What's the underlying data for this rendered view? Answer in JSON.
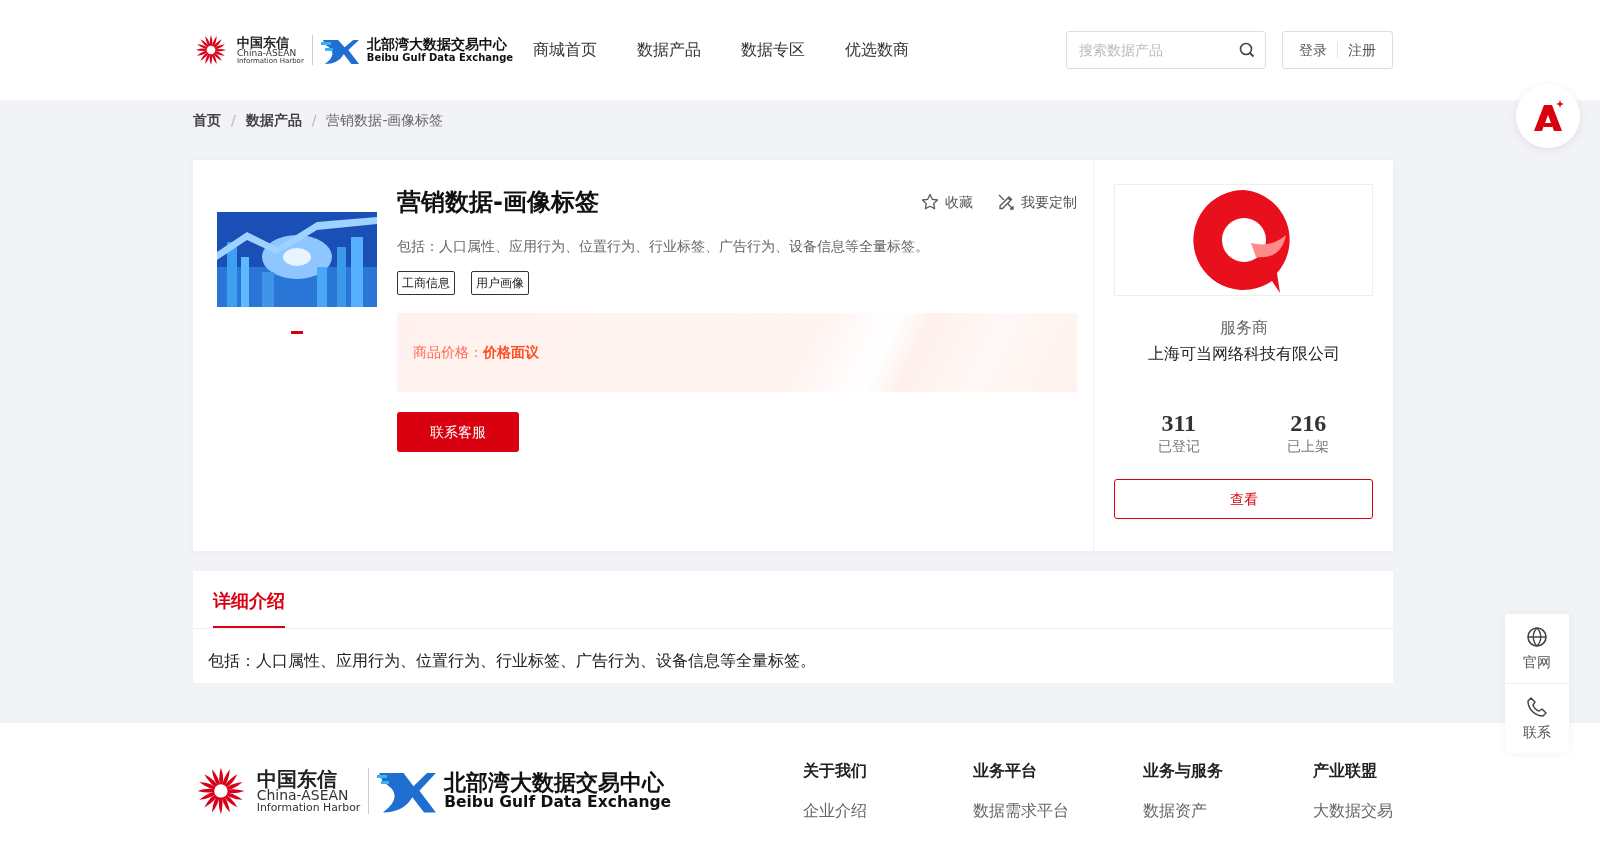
{
  "header": {
    "logo": {
      "cn": "中国东信",
      "en1": "China-ASEAN",
      "en2": "Information Harbor",
      "title": "北部湾大数据交易中心",
      "subtitle": "Beibu Gulf Data Exchange"
    },
    "nav": [
      {
        "label": "商城首页"
      },
      {
        "label": "数据产品"
      },
      {
        "label": "数据专区"
      },
      {
        "label": "优选数商"
      }
    ],
    "search": {
      "placeholder": "搜索数据产品"
    },
    "auth": [
      "登录",
      "注册"
    ]
  },
  "breadcrumb_separator": "/",
  "breadcrumb": [
    {
      "label": "首页",
      "current": false
    },
    {
      "label": "数据产品",
      "current": false
    },
    {
      "label": "营销数据-画像标签",
      "current": true
    }
  ],
  "product": {
    "title": "营销数据-画像标签",
    "actions": [
      "收藏",
      "我要定制"
    ],
    "description": "包括：人口属性、应用行为、位置行为、行业标签、广告行为、设备信息等全量标签。",
    "tags": [
      "工商信息",
      "用户画像"
    ],
    "price_label": "商品价格：",
    "price": "价格面议",
    "contact_button": "联系客服",
    "slides": [
      {
        "selected": true
      }
    ]
  },
  "provider": {
    "role": "服务商",
    "name": "上海可当网络科技有限公司",
    "stats": [
      {
        "value": "311",
        "label": "已登记"
      },
      {
        "value": "216",
        "label": "已上架"
      }
    ],
    "button": "查看"
  },
  "detail": {
    "tabs": [
      {
        "label": "详细介绍",
        "selected": true
      }
    ],
    "text": "包括：人口属性、应用行为、位置行为、行业标签、广告行为、设备信息等全量标签。"
  },
  "side_tools": [
    {
      "kind": "globe",
      "label": "官网"
    },
    {
      "kind": "phone",
      "label": "联系"
    }
  ],
  "footer": {
    "logo": {
      "cn": "中国东信",
      "en1": "China-ASEAN",
      "en2": "Information Harbor",
      "title": "北部湾大数据交易中心",
      "subtitle": "Beibu Gulf Data Exchange"
    },
    "columns": [
      {
        "heading": "关于我们",
        "links": [
          "企业介绍"
        ]
      },
      {
        "heading": "业务平台",
        "links": [
          "数据需求平台"
        ]
      },
      {
        "heading": "业务与服务",
        "links": [
          "数据资产"
        ]
      },
      {
        "heading": "产业联盟",
        "links": [
          "大数据交易"
        ]
      }
    ]
  }
}
